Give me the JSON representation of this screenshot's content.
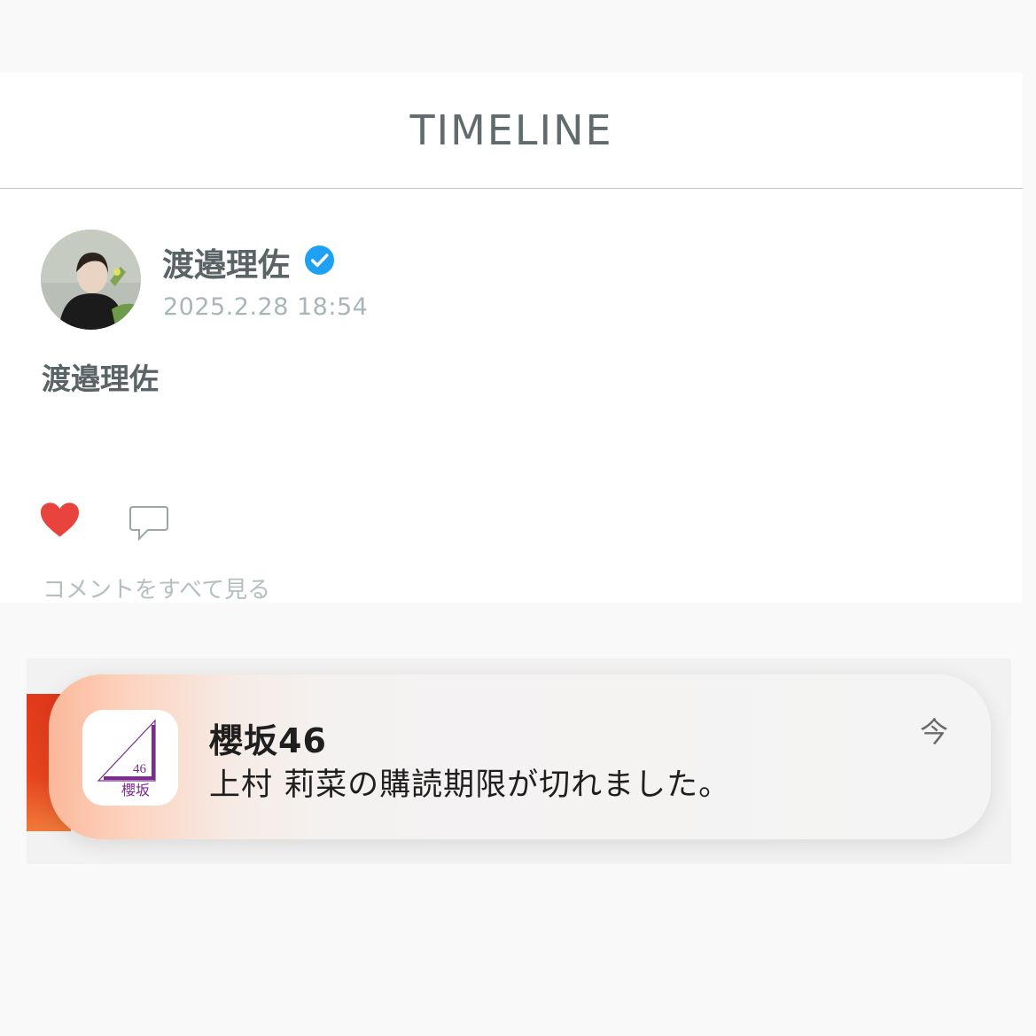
{
  "header": {
    "title": "TIMELINE"
  },
  "post": {
    "author": "渡邉理佐",
    "verified": true,
    "timestamp": "2025.2.28 18:54",
    "body": "渡邉理佐",
    "liked": true,
    "view_comments_label": "コメントをすべて見る"
  },
  "notification": {
    "app_name": "櫻坂46",
    "message": "上村 莉菜の購読期限が切れました。",
    "time": "今",
    "icon_text_top": "46",
    "icon_text_bottom": "櫻坂"
  },
  "icons": {
    "verified": "verified-check-icon",
    "like": "heart-icon",
    "comment": "comment-bubble-icon"
  },
  "colors": {
    "verified": "#1ea1f2",
    "heart": "#e8433c",
    "app_logo": "#7b2d8e"
  }
}
